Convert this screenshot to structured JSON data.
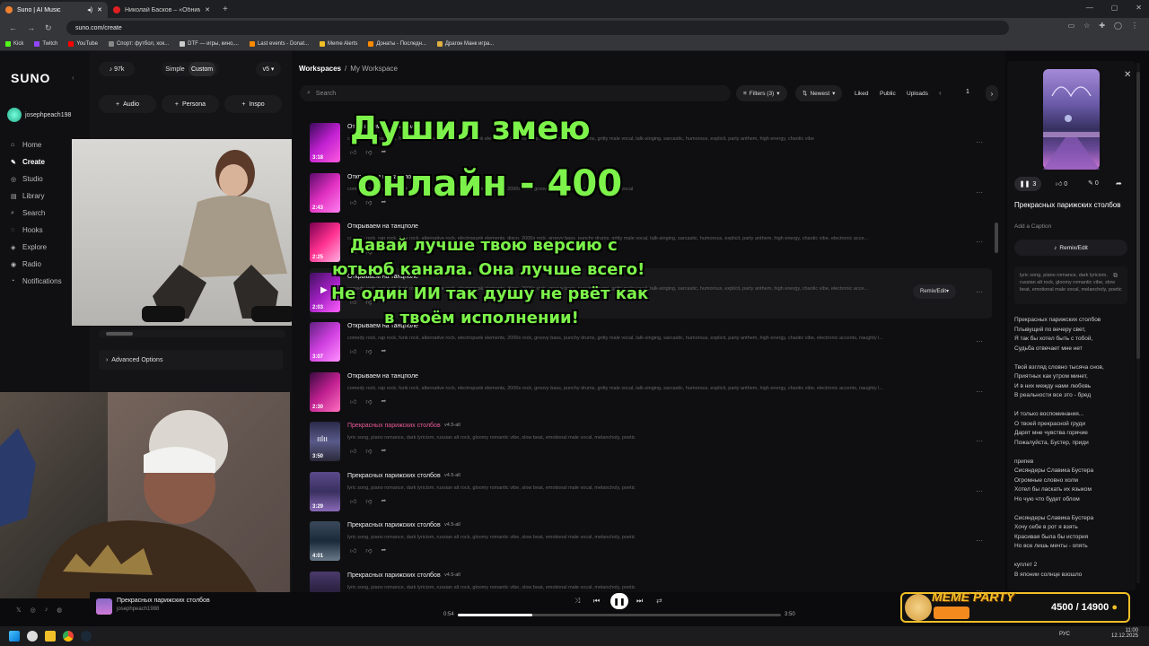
{
  "browser": {
    "tabs": [
      {
        "title": "Suno | AI Music",
        "color": "#f08030"
      },
      {
        "title": "Николай Басков – «Обниму»",
        "color": "#e02020"
      }
    ],
    "url": "suno.com/create",
    "bookmarks": [
      {
        "label": "Kick",
        "color": "#53fc18"
      },
      {
        "label": "Twitch",
        "color": "#9146ff"
      },
      {
        "label": "YouTube",
        "color": "#ff0000"
      },
      {
        "label": "Спорт: футбол, хок...",
        "color": "#888888"
      },
      {
        "label": "DTF — игры, кино,...",
        "color": "#cccccc"
      },
      {
        "label": "Last events - Donat...",
        "color": "#ff8a00"
      },
      {
        "label": "Meme Alerts",
        "color": "#f2c028"
      },
      {
        "label": "Донаты - Последн...",
        "color": "#ff8a00"
      },
      {
        "label": "Драгон Манк игра...",
        "color": "#e0b040"
      }
    ]
  },
  "sidebar": {
    "logo": "SUNO",
    "username": "josephpeach198",
    "items": [
      {
        "label": "Home",
        "icon": "⌂"
      },
      {
        "label": "Create",
        "icon": "✎"
      },
      {
        "label": "Studio",
        "icon": "◎"
      },
      {
        "label": "Library",
        "icon": "▤"
      },
      {
        "label": "Search",
        "icon": "⌕"
      },
      {
        "label": "Hooks",
        "icon": "◌"
      },
      {
        "label": "Explore",
        "icon": "◈"
      },
      {
        "label": "Radio",
        "icon": "◉"
      },
      {
        "label": "Notifications",
        "icon": "◔"
      }
    ]
  },
  "create": {
    "credits": "97k",
    "simple": "Simple",
    "custom": "Custom",
    "version": "v5",
    "audio": "Audio",
    "persona": "Persona",
    "inspo": "Inspo",
    "advanced": "Advanced Options"
  },
  "workspace": {
    "title": "Workspaces",
    "sub": "My Workspace",
    "search_placeholder": "Search",
    "filters": "Filters (3)",
    "sort": "Newest",
    "liked": "Liked",
    "public": "Public",
    "uploads": "Uploads",
    "page": "1"
  },
  "songs": [
    {
      "title": "Открываем на танцполе",
      "tags": "comedy rock, rap rock, funk rock, alternative rock, electropunk elements, 2000s rock, groovy bass, punchy drums, gritty male vocal, talk-singing, sarcastic, humorous, explicit, party anthem, high energy, chaotic vibe",
      "duration": "3:18",
      "version": ""
    },
    {
      "title": "Открываем на танцполе",
      "tags": "comedy rock, rap rock, funk rock, alternative rock, electropunk elements, 2000s rock, groovy bass, punchy drums, gritty male vocal",
      "duration": "2:43",
      "version": ""
    },
    {
      "title": "Открываем на танцполе",
      "tags": "comedy rock, rap rock, funk rock, alternative rock, electropunk elements, disco, 2000s rock, groovy bass, punchy drums, gritty male vocal, talk-singing, sarcastic, humorous, explicit, party anthem, high energy, chaotic vibe, electronic acce...",
      "duration": "2:25",
      "version": ""
    },
    {
      "title": "Открываем на танцполе",
      "tags": "comedy rock, rap rock, funk rock, alternative rock, electropunk elements, disco, 2000s rock, groovy bass, punchy drums, gritty male vocal, talk-singing, sarcastic, humorous, explicit, party anthem, high energy, chaotic vibe, electronic acce...",
      "duration": "2:03",
      "version": ""
    },
    {
      "title": "Открываем на танцполе",
      "tags": "comedy rock, rap rock, funk rock, alternative rock, electropunk elements, 2000s rock, groovy bass, punchy drums, gritty male vocal, talk-singing, sarcastic, humorous, explicit, party anthem, high energy, chaotic vibe, electronic accents, naughty l...",
      "duration": "3:07",
      "version": ""
    },
    {
      "title": "Открываем на танцполе",
      "tags": "comedy rock, rap rock, funk rock, alternative rock, electropunk elements, 2000s rock, groovy bass, punchy drums, gritty male vocal, talk-singing, sarcastic, humorous, explicit, party anthem, high energy, chaotic vibe, electronic accents, naughty l...",
      "duration": "2:30",
      "version": ""
    },
    {
      "title": "Прекрасных парижских столбов",
      "tags": "lyric song, piano romance, dark lyricism, russian alt rock, gloomy romantic vibe, slow beat, emotional male vocal, melancholy, poetic",
      "duration": "3:50",
      "version": "v4.5-all"
    },
    {
      "title": "Прекрасных парижских столбов",
      "tags": "lyric song, piano romance, dark lyricism, russian alt rock, gloomy romantic vibe, slow beat, emotional male vocal, melancholy, poetic",
      "duration": "3:29",
      "version": "v4.5-all"
    },
    {
      "title": "Прекрасных парижских столбов",
      "tags": "lyric song, piano romance, dark lyricism, russian alt rock, gloomy romantic vibe, slow beat, emotional male vocal, melancholy, poetic",
      "duration": "4:01",
      "version": "v4.5-all"
    },
    {
      "title": "Прекрасных парижских столбов",
      "tags": "lyric song, piano romance, dark lyricism, russian alt rock, gloomy romantic vibe, slow beat, emotional male vocal, melancholy, poetic",
      "duration": "",
      "version": "v4.5-all"
    }
  ],
  "remix_row": "Remix/Edit",
  "overlay": {
    "line1": "Душил змею",
    "line2": "онлайн - 400",
    "msg1": "Давай лучше твою версию с",
    "msg2": "ютьюб канала. Она лучше всего!",
    "msg3": "Не один ИИ так душу не рвёт как",
    "msg4": "в твоём исполнении!"
  },
  "detail": {
    "plays": "3",
    "likes": "0",
    "comments": "0",
    "title": "Прекрасных парижских столбов",
    "caption": "Add a Caption",
    "remix": "Remix/Edit",
    "style": "lyric song, piano romance, dark lyricism, russian alt rock, gloomy romantic vibe, slow beat, emotional male vocal, melancholy, poetic",
    "lyrics": [
      "Прекрасных парижских столбов",
      "Плывущий по вечеру свет,",
      "Я так бы хотел быть с тобой,",
      "Судьба отвечает мне нет",
      "",
      "Твой взгляд словно тысяча снов,",
      "Приятных как утром минет,",
      "И в них между нами любовь",
      "В реальности все это - бред",
      "",
      "И только воспоминания...",
      "О твоей прекрасной груди",
      "Дарят мне чувства горячие",
      "Пожалуйста, Бустер, приди",
      "",
      "припев",
      "Сисяндеры Славика Бустера",
      "Огромные словно холм",
      "Хотел бы ласкать их языком",
      "Но чую что будет облом",
      "",
      "Сисяндеры Славика Бустера",
      "Хочу себе в рот я взять",
      "Красивая была бы история",
      "Но все лишь мечты - опять",
      "",
      "куплет 2",
      "В японии солнце взошло"
    ]
  },
  "player": {
    "title": "Прекрасных парижских столбов",
    "artist": "josephpeach1988",
    "current": "0:54",
    "total": "3:50",
    "progress": 0.23
  },
  "donation": {
    "label": "MEME PARTY",
    "amount": "4500 / 14900"
  },
  "taskbar": {
    "lang": "РУС",
    "time": "11:00",
    "date": "12.12.2025"
  }
}
